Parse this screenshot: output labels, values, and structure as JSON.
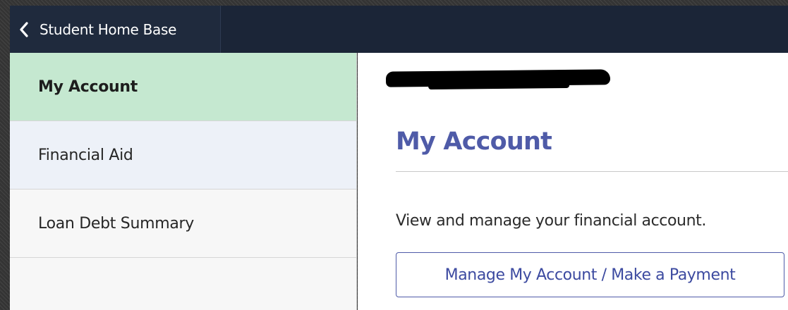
{
  "header": {
    "back_label": "Student Home Base",
    "back_icon": "chevron-left-icon"
  },
  "sidebar": {
    "items": [
      {
        "label": "My Account",
        "active": true
      },
      {
        "label": "Financial Aid",
        "active": false
      },
      {
        "label": "Loan Debt Summary",
        "active": false
      }
    ]
  },
  "main": {
    "title": "My Account",
    "description": "View and manage your financial account.",
    "button_label": "Manage My Account / Make a Payment"
  },
  "colors": {
    "header_bg": "#1b2537",
    "active_item_bg": "#c5e8d0",
    "title_color": "#4f5ba8",
    "button_border": "#4f5ba8"
  }
}
